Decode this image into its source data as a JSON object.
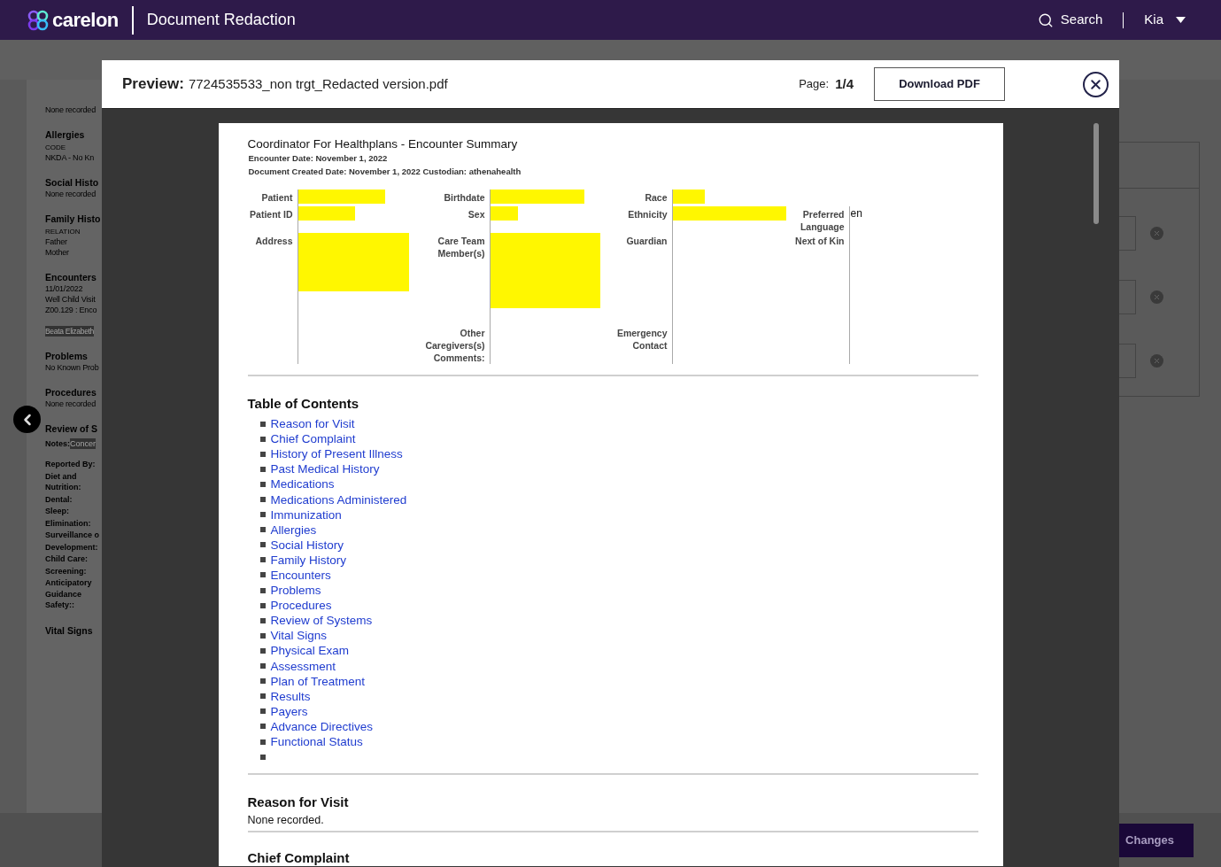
{
  "app_header": {
    "brand": "carelon",
    "title": "Document Redaction",
    "search_label": "Search",
    "user": "Kia"
  },
  "background_record": [
    {
      "kind": "text",
      "text": "None recorded"
    },
    {
      "kind": "heading",
      "text": "Allergies"
    },
    {
      "kind": "caption",
      "text": "CODE"
    },
    {
      "kind": "text",
      "text": "NKDA - No Kn"
    },
    {
      "kind": "heading",
      "text": "Social Histo"
    },
    {
      "kind": "text",
      "text": "None recorded"
    },
    {
      "kind": "heading",
      "text": "Family Histo"
    },
    {
      "kind": "caption",
      "text": "RELATION"
    },
    {
      "kind": "text",
      "text": "Father"
    },
    {
      "kind": "text",
      "text": "Mother"
    },
    {
      "kind": "heading",
      "text": "Encounters"
    },
    {
      "kind": "text",
      "text": "11/01/2022"
    },
    {
      "kind": "text",
      "text": "Well Child Visit"
    },
    {
      "kind": "text",
      "text": "Z00.129 : Enco"
    },
    {
      "kind": "highlight",
      "text": "Beata Elizabeth"
    },
    {
      "kind": "heading",
      "text": "Problems"
    },
    {
      "kind": "text",
      "text": "No Known Prob"
    },
    {
      "kind": "heading",
      "text": "Procedures"
    },
    {
      "kind": "text",
      "text": "None recorded"
    },
    {
      "kind": "heading",
      "text": "Review of S"
    },
    {
      "kind": "notes",
      "text": "Notes:",
      "value": "Concer"
    },
    {
      "kind": "label",
      "text": "Reported By:"
    },
    {
      "kind": "label",
      "text": "Diet and Nutrition:"
    },
    {
      "kind": "label",
      "text": "Dental:"
    },
    {
      "kind": "label",
      "text": "Sleep:"
    },
    {
      "kind": "label",
      "text": "Elimination:"
    },
    {
      "kind": "label",
      "text": "Surveillance o"
    },
    {
      "kind": "label",
      "text": "Development:"
    },
    {
      "kind": "label",
      "text": "Child Care:"
    },
    {
      "kind": "label",
      "text": "Screening:"
    },
    {
      "kind": "label",
      "text": "Anticipatory Guidance Safety::"
    },
    {
      "kind": "heading",
      "text": "Vital Signs"
    }
  ],
  "side_panel": {
    "fields": [
      {
        "clearable": true
      },
      {
        "clearable": true
      },
      {
        "clearable": true
      }
    ]
  },
  "footer": {
    "save_button": "Changes"
  },
  "preview_modal": {
    "label": "Preview:",
    "file_name": "7724535533_non trgt_Redacted version.pdf",
    "page_label": "Page:",
    "page_value": "1/4",
    "download_button": "Download PDF"
  },
  "pdf_page": {
    "title": "Coordinator For Healthplans - Encounter Summary",
    "encounter_date": "Encounter Date: November 1, 2022",
    "created_line": "Document Created Date: November 1, 2022 Custodian: athenahealth",
    "demographics": [
      [
        {
          "label": "Patient",
          "redacted": true
        },
        {
          "label": "Patient ID",
          "redacted": true
        },
        {
          "label": "Address",
          "redacted": true
        }
      ],
      [
        {
          "label": "Birthdate",
          "redacted": true
        },
        {
          "label": "Sex",
          "redacted": true
        },
        {
          "label": "Care Team Member(s)",
          "redacted": true
        },
        {
          "label": "Other Caregivers(s) Comments:",
          "redacted": false
        }
      ],
      [
        {
          "label": "Race",
          "redacted": true
        },
        {
          "label": "Ethnicity",
          "redacted": true
        },
        {
          "label": "Guardian",
          "redacted": false
        },
        {
          "label": "Emergency Contact",
          "redacted": false
        }
      ],
      [
        {
          "label": "Preferred Language",
          "value": "en",
          "redacted": false
        },
        {
          "label": "Next of Kin",
          "redacted": false
        }
      ]
    ],
    "toc_title": "Table of Contents",
    "toc": [
      "Reason for Visit",
      "Chief Complaint",
      "History of Present Illness",
      "Past Medical History",
      "Medications",
      "Medications Administered",
      "Immunization",
      "Allergies",
      "Social History",
      "Family History",
      "Encounters",
      "Problems",
      "Procedures",
      "Review of Systems",
      "Vital Signs",
      "Physical Exam",
      "Assessment",
      "Plan of Treatment",
      "Results",
      "Payers",
      "Advance Directives",
      "Functional Status"
    ],
    "toc_trailing_bullet": true,
    "sections": [
      {
        "title": "Reason for Visit",
        "text": "None recorded."
      },
      {
        "title": "Chief Complaint"
      }
    ]
  }
}
